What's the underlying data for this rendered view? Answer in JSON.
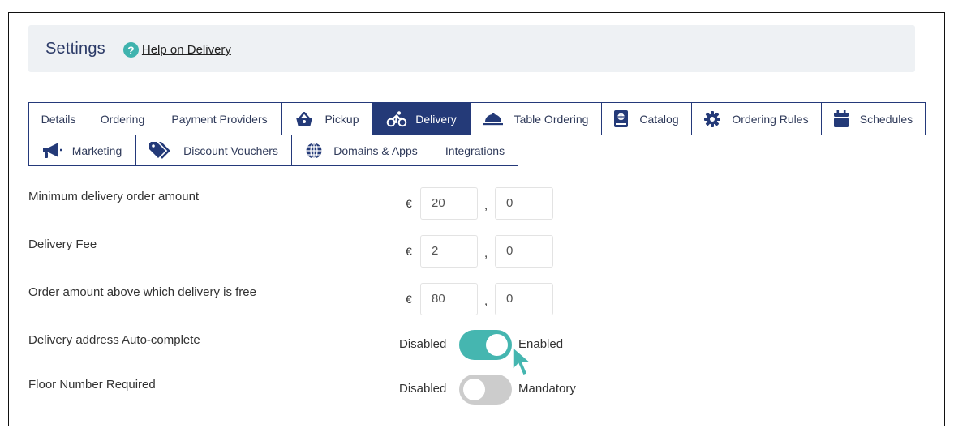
{
  "header": {
    "title": "Settings",
    "help_icon": "question-circle-icon",
    "help_link": "Help on Delivery"
  },
  "tabs": [
    {
      "label": "Details",
      "icon": null,
      "active": false
    },
    {
      "label": "Ordering",
      "icon": null,
      "active": false
    },
    {
      "label": "Payment Providers",
      "icon": null,
      "active": false
    },
    {
      "label": "Pickup",
      "icon": "basket-icon",
      "active": false
    },
    {
      "label": "Delivery",
      "icon": "bicycle-icon",
      "active": true
    },
    {
      "label": "Table Ordering",
      "icon": "cloche-icon",
      "active": false
    },
    {
      "label": "Catalog",
      "icon": "book-icon",
      "active": false
    },
    {
      "label": "Ordering Rules",
      "icon": "gear-icon",
      "active": false
    },
    {
      "label": "Schedules",
      "icon": "calendar-icon",
      "active": false
    },
    {
      "label": "Marketing",
      "icon": "megaphone-icon",
      "active": false
    },
    {
      "label": "Discount Vouchers",
      "icon": "tags-icon",
      "active": false
    },
    {
      "label": "Domains & Apps",
      "icon": "globe-icon",
      "active": false
    },
    {
      "label": "Integrations",
      "icon": null,
      "active": false
    }
  ],
  "fields": {
    "currency_symbol": "€",
    "decimal_separator": ",",
    "min_order": {
      "label": "Minimum delivery order amount",
      "integer": "20",
      "decimal": "0"
    },
    "delivery_fee": {
      "label": "Delivery Fee",
      "integer": "2",
      "decimal": "0"
    },
    "free_delivery": {
      "label": "Order amount above which delivery is free",
      "integer": "80",
      "decimal": "0"
    }
  },
  "toggles": {
    "autocomplete": {
      "label": "Delivery address Auto-complete",
      "off_label": "Disabled",
      "on_label": "Enabled",
      "state": "on"
    },
    "floor_number": {
      "label": "Floor Number Required",
      "off_label": "Disabled",
      "on_label": "Mandatory",
      "state": "off"
    }
  },
  "colors": {
    "primary": "#243a78",
    "accent": "#45b6b0",
    "toggle_off": "#cccccc"
  }
}
